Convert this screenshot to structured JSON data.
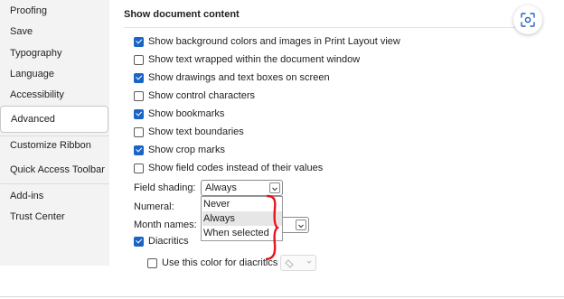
{
  "sidebar": {
    "items": [
      {
        "label": "Proofing"
      },
      {
        "label": "Save"
      },
      {
        "label": "Typography"
      },
      {
        "label": "Language"
      },
      {
        "label": "Accessibility"
      },
      {
        "label": "Advanced",
        "active": true
      },
      {
        "label": "Customize Ribbon"
      },
      {
        "label": "Quick Access Toolbar"
      },
      {
        "label": "Add-ins"
      },
      {
        "label": "Trust Center"
      }
    ]
  },
  "main": {
    "section_title": "Show document content",
    "options": [
      {
        "label": "Show background colors and images in Print Layout view",
        "checked": true
      },
      {
        "label": "Show text wrapped within the document window",
        "checked": false
      },
      {
        "label": "Show drawings and text boxes on screen",
        "checked": true
      },
      {
        "label": "Show control characters",
        "checked": false
      },
      {
        "label": "Show bookmarks",
        "checked": true
      },
      {
        "label": "Show text boundaries",
        "checked": false
      },
      {
        "label": "Show crop marks",
        "checked": true
      },
      {
        "label": "Show field codes instead of their values",
        "checked": false
      }
    ],
    "field_shading": {
      "label": "Field shading:",
      "value": "Always",
      "options": [
        "Never",
        "Always",
        "When selected"
      ]
    },
    "numeral": {
      "label": "Numeral:"
    },
    "month_names": {
      "label": "Month names:"
    },
    "diacritics": {
      "label": "Diacritics",
      "checked": true
    },
    "diacritic_color": {
      "label": "Use this color for diacritics",
      "checked": false
    }
  },
  "colors": {
    "accent": "#1a64c6",
    "annotation": "#e8141e",
    "sidebar_bg": "#f3f3f3"
  }
}
